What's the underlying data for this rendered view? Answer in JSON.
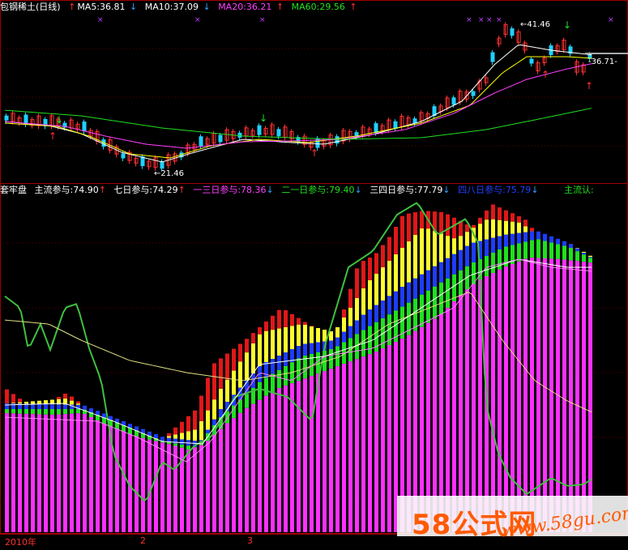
{
  "header": {
    "stock_name": "包钢稀土(日线)",
    "ma5": "MA5:36.81",
    "ma10": "MA10:37.09",
    "ma20": "MA20:36.21",
    "ma60": "MA60:29.56",
    "colors": {
      "name": "#ffffff",
      "ma5": "#ffffff",
      "ma10": "#ffff00",
      "ma20": "#ff40ff",
      "ma60": "#20e020",
      "arrow_up": "#ff3030",
      "arrow_down": "#30a0ff"
    }
  },
  "indicator_header": {
    "name": "套牢盘",
    "main": "主流参与:74.90",
    "seven": "七日参与:74.29",
    "one_three": "一三日参与:78.36",
    "two_one": "二一日参与:79.40",
    "three_four": "三四日参与:77.79",
    "four_eight": "四八日参与:75.79",
    "confirm": "主流认:",
    "colors": {
      "main": "#ffffff",
      "seven": "#ffffff",
      "one_three": "#ff40ff",
      "two_one": "#20e020",
      "three_four": "#ffffff",
      "four_eight": "#2040ff",
      "confirm": "#20e020"
    }
  },
  "price_annotations": {
    "high": "41.46",
    "low": "21.46",
    "last": "36.71"
  },
  "x_axis": {
    "labels": [
      "2010年",
      "2",
      "3"
    ]
  },
  "watermark": {
    "logo": "58公式网",
    "url": "www.58gu.com"
  },
  "chart_data": [
    {
      "type": "candlestick",
      "title": "包钢稀土(日线)",
      "series": [
        {
          "name": "MA5",
          "values": [
            36.81
          ]
        },
        {
          "name": "MA10",
          "values": [
            37.09
          ]
        },
        {
          "name": "MA20",
          "values": [
            36.21
          ]
        },
        {
          "name": "MA60",
          "values": [
            29.56
          ]
        }
      ],
      "annotations": [
        "41.46",
        "21.46",
        "36.71"
      ]
    },
    {
      "type": "bar",
      "title": "套牢盘",
      "series": [
        {
          "name": "主流参与",
          "values": [
            74.9
          ]
        },
        {
          "name": "七日参与",
          "values": [
            74.29
          ]
        },
        {
          "name": "一三日参与",
          "values": [
            78.36
          ]
        },
        {
          "name": "二一日参与",
          "values": [
            79.4
          ]
        },
        {
          "name": "三四日参与",
          "values": [
            77.79
          ]
        },
        {
          "name": "四八日参与",
          "values": [
            75.79
          ]
        }
      ]
    }
  ]
}
